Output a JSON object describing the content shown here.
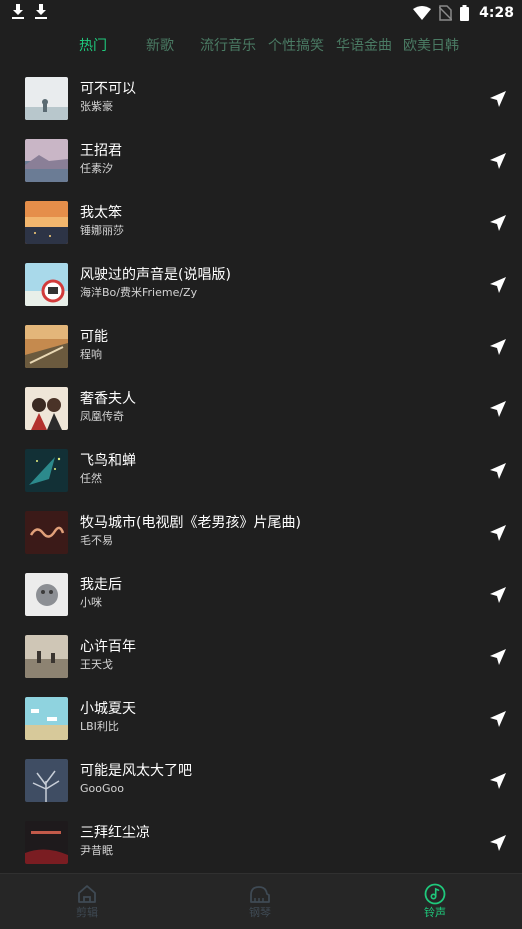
{
  "status_bar": {
    "time": "4:28",
    "icons": [
      "download-icon",
      "download-icon",
      "wifi-icon",
      "no-sim-icon",
      "battery-icon"
    ]
  },
  "tabs": [
    {
      "label": "热门",
      "active": true
    },
    {
      "label": "新歌",
      "active": false
    },
    {
      "label": "流行音乐",
      "active": false
    },
    {
      "label": "个性搞笑",
      "active": false
    },
    {
      "label": "华语金曲",
      "active": false
    },
    {
      "label": "欧美日韩",
      "active": false
    }
  ],
  "songs": [
    {
      "title": "可不可以",
      "artist": "张紫豪",
      "action_icon": "send-icon"
    },
    {
      "title": "王招君",
      "artist": "任素汐",
      "action_icon": "send-icon"
    },
    {
      "title": "我太笨",
      "artist": "锤娜丽莎",
      "action_icon": "send-icon"
    },
    {
      "title": "风驶过的声音是(说唱版)",
      "artist": "海洋Bo/费米Frieme/Zy",
      "action_icon": "send-icon"
    },
    {
      "title": "可能",
      "artist": "程响",
      "action_icon": "send-icon"
    },
    {
      "title": "奢香夫人",
      "artist": "凤凰传奇",
      "action_icon": "send-icon"
    },
    {
      "title": "飞鸟和蝉",
      "artist": "任然",
      "action_icon": "send-icon"
    },
    {
      "title": "牧马城市(电视剧《老男孩》片尾曲)",
      "artist": "毛不易",
      "action_icon": "send-icon"
    },
    {
      "title": "我走后",
      "artist": "小咪",
      "action_icon": "send-icon"
    },
    {
      "title": "心许百年",
      "artist": "王天戈",
      "action_icon": "send-icon"
    },
    {
      "title": "小城夏天",
      "artist": "LBI利比",
      "action_icon": "send-icon"
    },
    {
      "title": "可能是风太大了吧",
      "artist": "GooGoo",
      "action_icon": "send-icon"
    },
    {
      "title": "三拜红尘凉",
      "artist": "尹昔眠",
      "action_icon": "send-icon"
    }
  ],
  "bottom_nav": [
    {
      "label": "剪辑",
      "icon": "home-icon",
      "active": false
    },
    {
      "label": "钢琴",
      "icon": "piano-icon",
      "active": false
    },
    {
      "label": "铃声",
      "icon": "music-note-icon",
      "active": true
    }
  ],
  "colors": {
    "background": "#1f1f1f",
    "accent": "#1fc97c",
    "tab_inactive": "#4a7a63",
    "nav_inactive": "#3f4a54"
  }
}
